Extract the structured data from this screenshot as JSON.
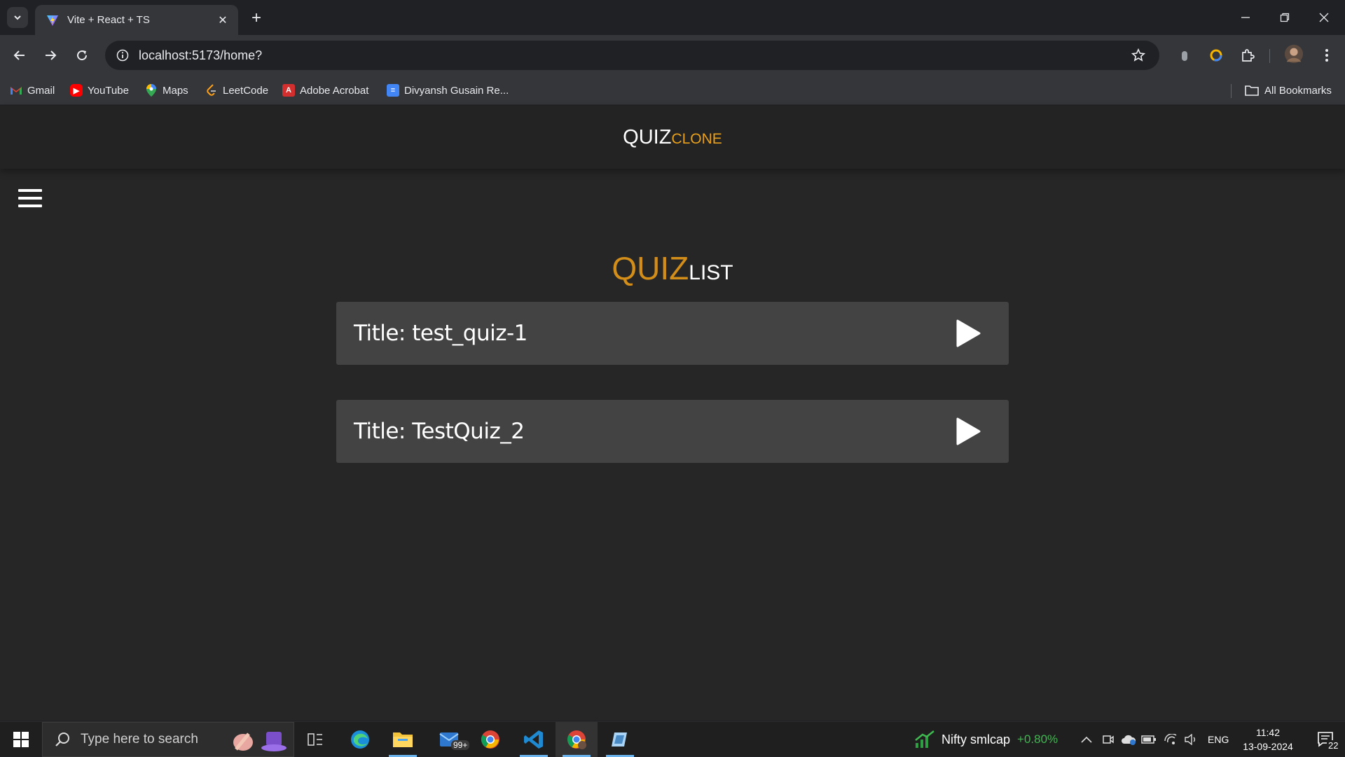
{
  "browser": {
    "tab_title": "Vite + React + TS",
    "url": "localhost:5173/home?",
    "bookmarks": [
      {
        "label": "Gmail",
        "icon": "gmail-icon",
        "color": "#ea4335"
      },
      {
        "label": "YouTube",
        "icon": "youtube-icon",
        "color": "#ff0000"
      },
      {
        "label": "Maps",
        "icon": "maps-icon",
        "color": "#34a853"
      },
      {
        "label": "LeetCode",
        "icon": "leetcode-icon",
        "color": "#ffa116"
      },
      {
        "label": "Adobe Acrobat",
        "icon": "acrobat-icon",
        "color": "#d32f2f"
      },
      {
        "label": "Divyansh Gusain Re...",
        "icon": "docs-icon",
        "color": "#4285f4"
      }
    ],
    "all_bookmarks": "All Bookmarks"
  },
  "app": {
    "brand_main": "QUIZ",
    "brand_sub": "CLONE",
    "list_title_main": "QUIZ",
    "list_title_sub": "LIST",
    "quizzes": [
      {
        "title": "Title: test_quiz-1"
      },
      {
        "title": "Title: TestQuiz_2"
      }
    ],
    "colors": {
      "accent": "#e8a01c",
      "card": "#434343",
      "background": "#262626"
    }
  },
  "taskbar": {
    "search_placeholder": "Type here to search",
    "mail_badge": "99+",
    "stock_name": "Nifty smlcap",
    "stock_change": "+0.80%",
    "language": "ENG",
    "time": "11:42",
    "date": "13-09-2024",
    "notification_count": "22"
  }
}
